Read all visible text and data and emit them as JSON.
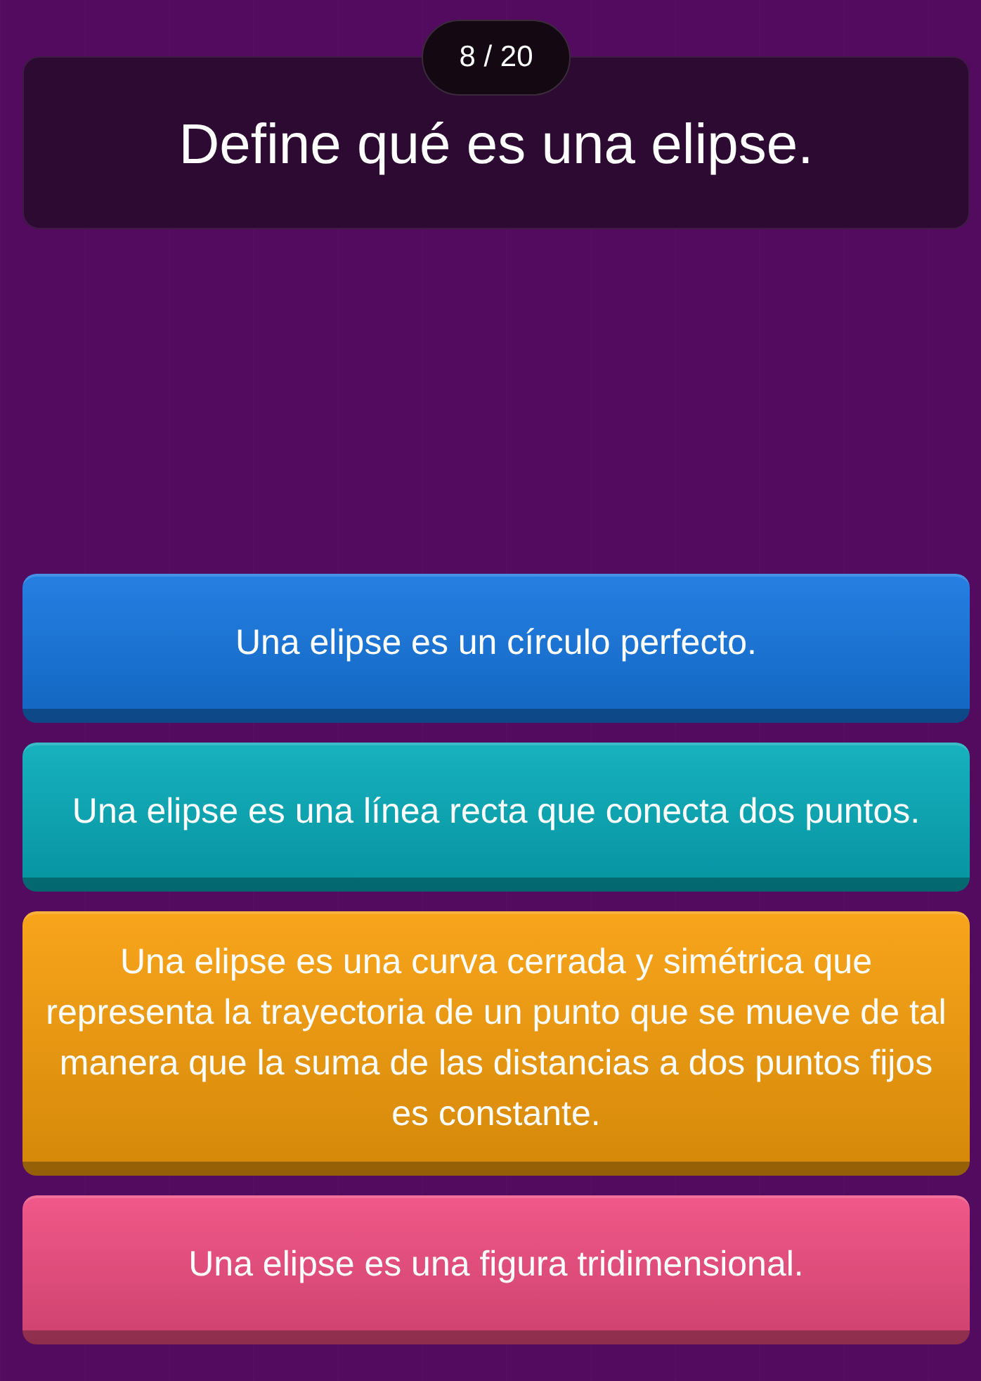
{
  "progress": "8 / 20",
  "question": "Define qué es una elipse.",
  "options": [
    {
      "text": "Una elipse es un círculo perfecto.",
      "color": "#1576e0"
    },
    {
      "text": "Una elipse es una línea recta que conecta dos puntos.",
      "color": "#06abb9"
    },
    {
      "text": "Una elipse es una curva cerrada y simétrica que representa la trayectoria de un punto que se mueve de tal manera que la suma de las distancias a dos puntos fijos es constante.",
      "color": "#f79e0a"
    },
    {
      "text": "Una elipse es una figura tridimensional.",
      "color": "#ef4c80"
    }
  ]
}
